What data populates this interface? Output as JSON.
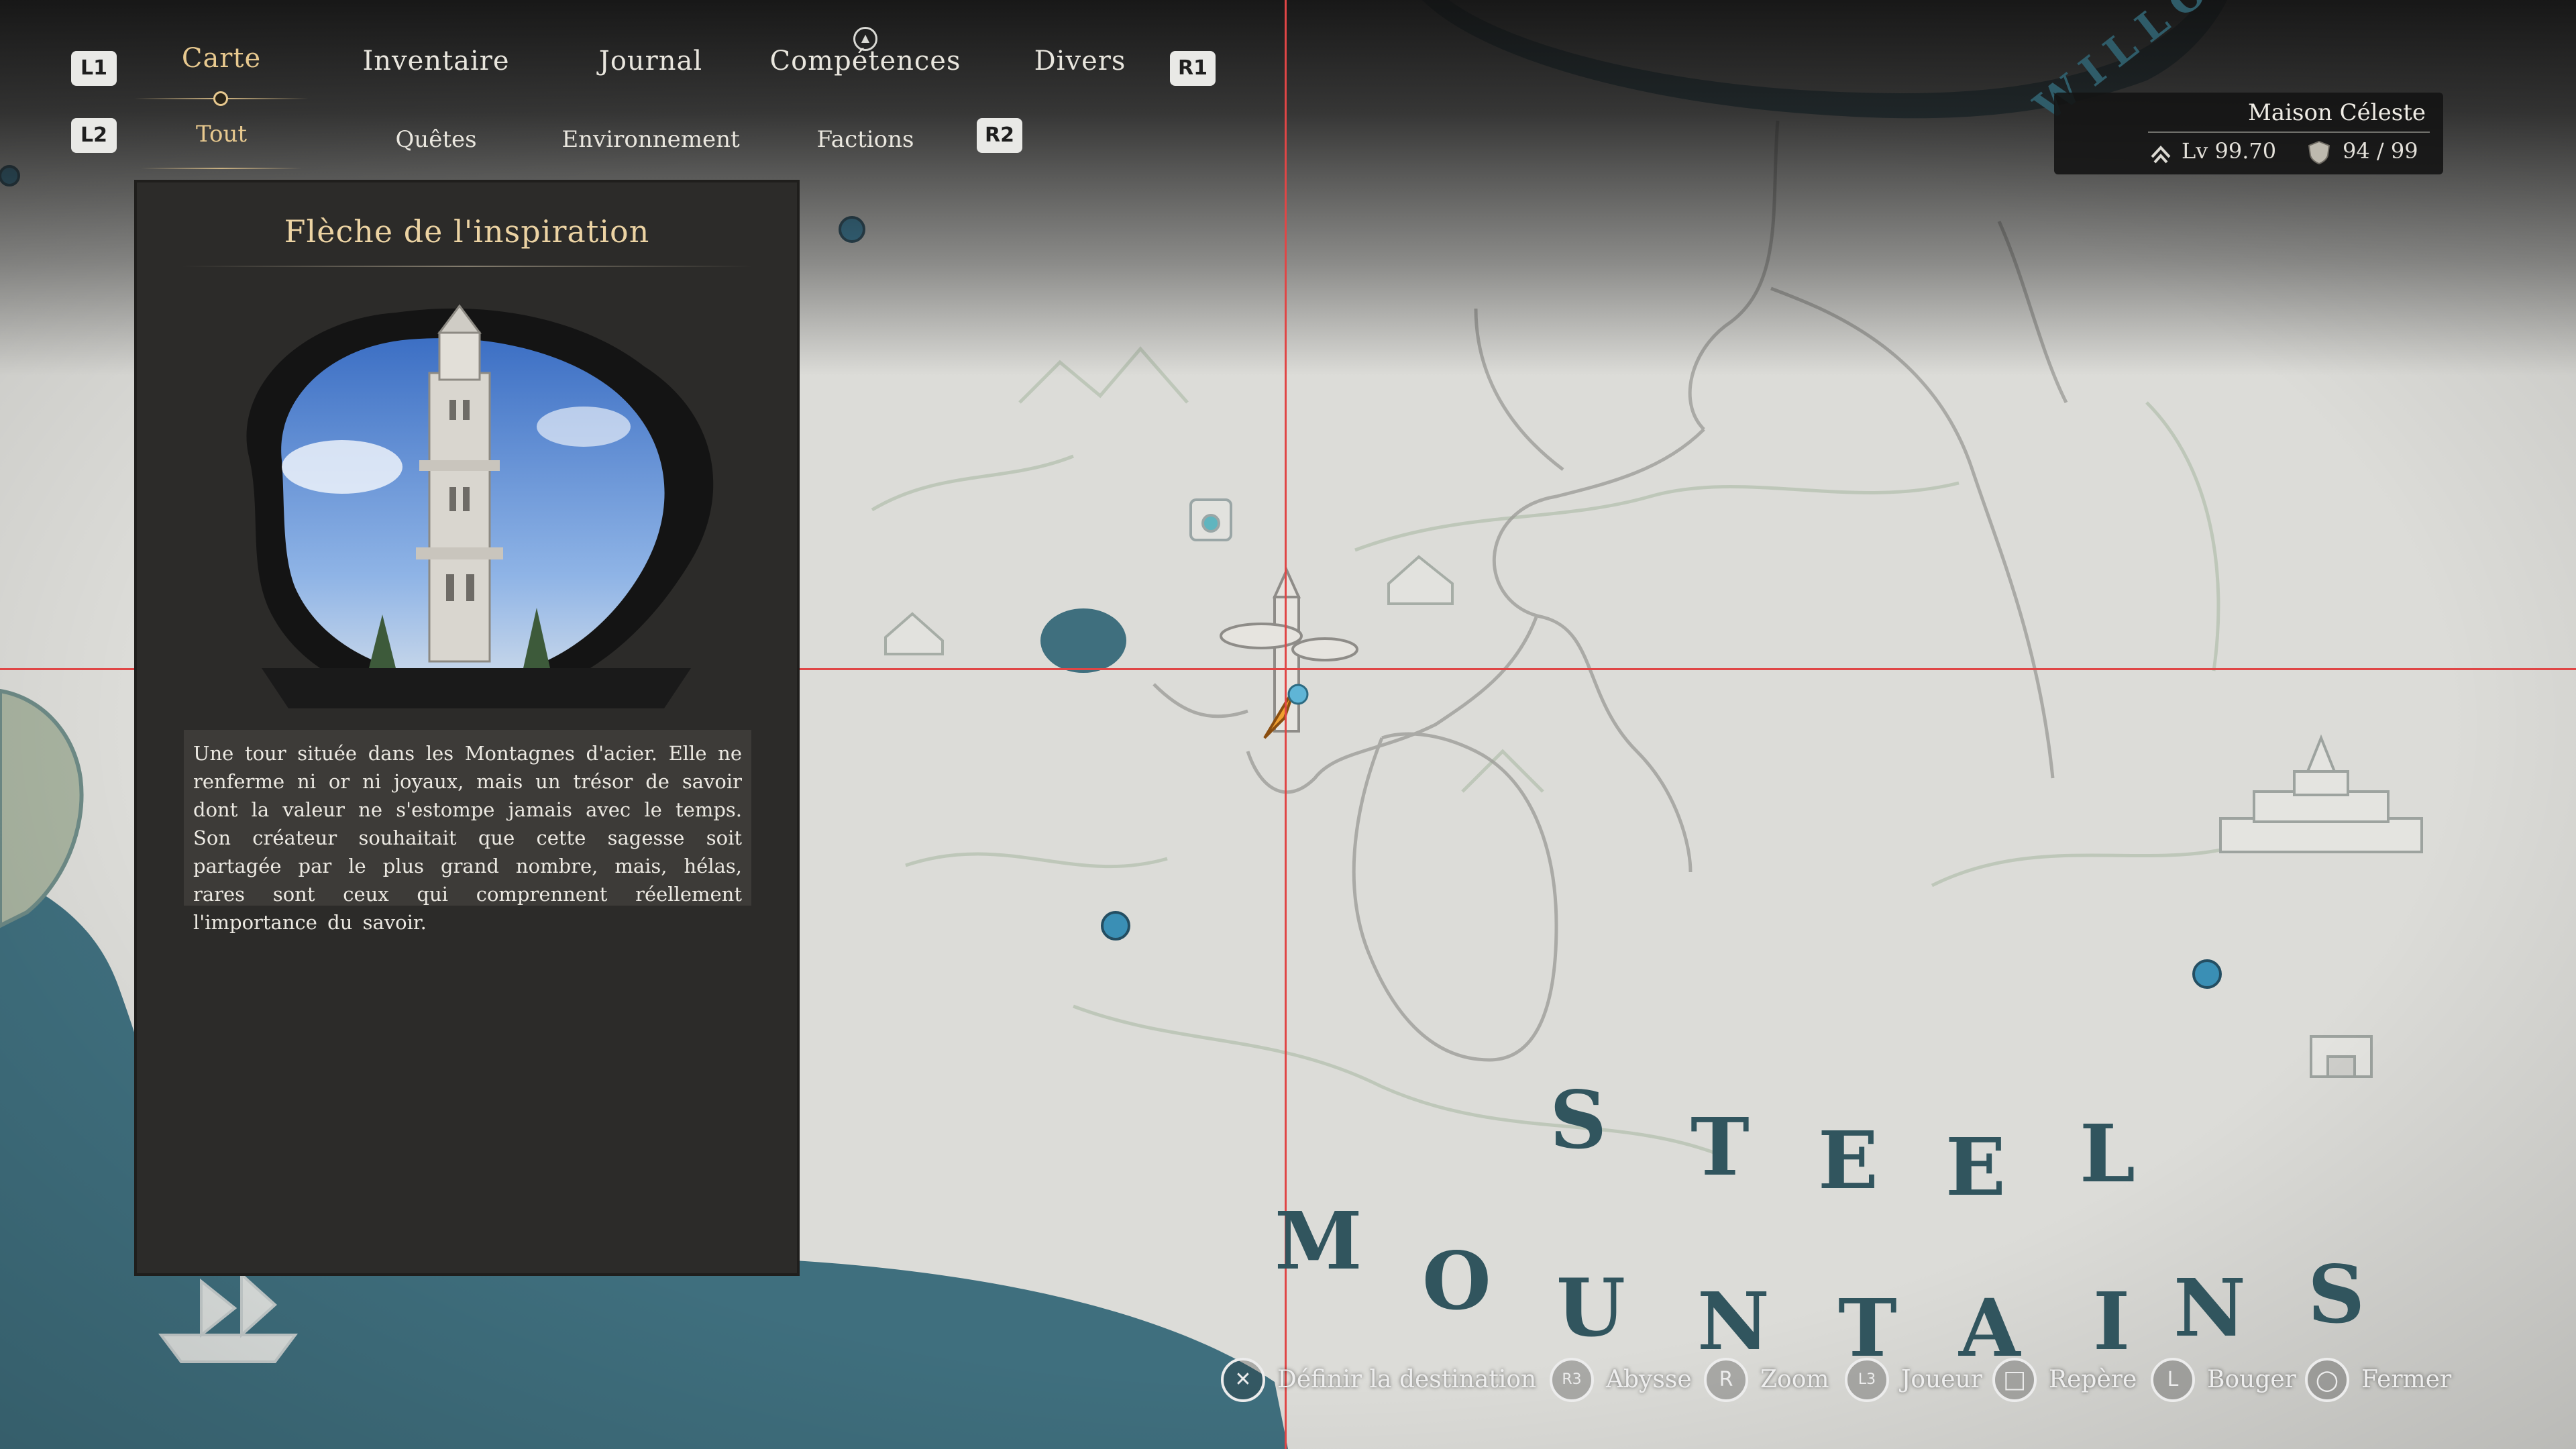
{
  "nav": {
    "shoulder_left_top": "L1",
    "shoulder_right_top": "R1",
    "shoulder_left_bottom": "L2",
    "shoulder_right_bottom": "R2",
    "main_tabs": [
      "Carte",
      "Inventaire",
      "Journal",
      "Compétences",
      "Divers"
    ],
    "active_main_tab": "Carte",
    "sub_tabs": [
      "Tout",
      "Quêtes",
      "Environnement",
      "Factions"
    ],
    "active_sub_tab": "Tout",
    "notification_icon": "triangle-button-icon"
  },
  "player": {
    "name": "Maison Céleste",
    "level": "Lv  99.70",
    "currency": "94  /  99",
    "level_icon": "rank-chevron-icon",
    "currency_icon": "shield-crest-icon"
  },
  "location": {
    "title": "Flèche de l'inspiration",
    "description": "Une tour située dans les Montagnes d'acier. Elle ne renferme ni or ni joyaux, mais un trésor de savoir dont la valeur ne s'estompe jamais avec le temps. Son créateur souhaitait que cette sagesse soit partagée par le plus grand nombre, mais, hélas, rares sont ceux qui comprennent réellement l'importance du savoir.",
    "image_subject": "white-tower-illustration"
  },
  "map": {
    "region_label": "STEEL MOUNTAINS",
    "river_label": "WILLOW RIVER",
    "colors": {
      "land": "#dcdcd8",
      "water": "#3f6f7e",
      "crosshair": "#e04646",
      "player_arrow": "#f0a030",
      "waypoint": "#3a8fb5"
    }
  },
  "footer": {
    "hints": [
      {
        "button": "✕",
        "label": "Définir la destination",
        "icon": "cross-button-icon"
      },
      {
        "button": "R3",
        "label": "Abysse",
        "icon": "r3-stick-icon"
      },
      {
        "button": "R",
        "label": "Zoom",
        "icon": "right-stick-icon"
      },
      {
        "button": "L3",
        "label": "Joueur",
        "icon": "l3-stick-icon"
      },
      {
        "button": "□",
        "label": "Repère",
        "icon": "square-button-icon"
      },
      {
        "button": "L",
        "label": "Bouger",
        "icon": "left-stick-icon"
      },
      {
        "button": "○",
        "label": "Fermer",
        "icon": "circle-button-icon"
      }
    ]
  }
}
